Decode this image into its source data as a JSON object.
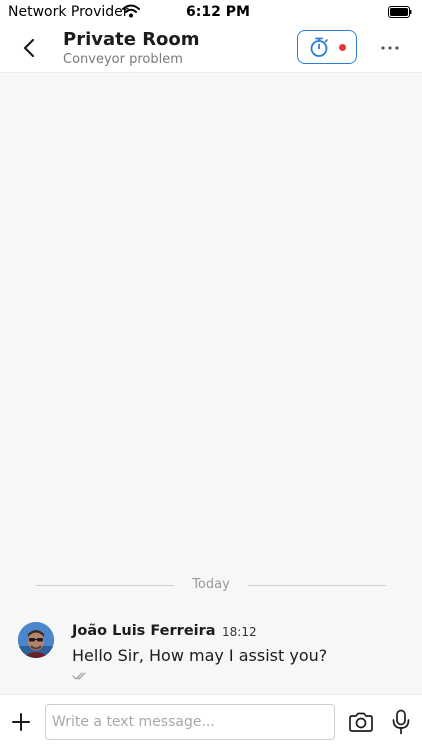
{
  "status_bar": {
    "carrier": "Network Provider",
    "time": "6:12 PM",
    "icons": [
      "wifi-icon",
      "battery-icon"
    ]
  },
  "header": {
    "title": "Private Room",
    "subtitle": "Conveyor problem",
    "icons": [
      "chevron-left-icon",
      "stopwatch-icon",
      "recording-dot-icon",
      "more-horizontal-icon"
    ]
  },
  "chat": {
    "date_divider": "Today",
    "messages": [
      {
        "sender": "João Luis Ferreira",
        "time": "18:12",
        "text": "Hello Sir, How may I assist you?",
        "status_icon": "double-check-icon"
      }
    ]
  },
  "composer": {
    "placeholder": "Write a text message...",
    "value": "",
    "icons": [
      "plus-icon",
      "camera-icon",
      "microphone-icon"
    ]
  },
  "colors": {
    "accent": "#2b7fd1",
    "recording": "#e53935",
    "background": "#f7f7f7"
  }
}
